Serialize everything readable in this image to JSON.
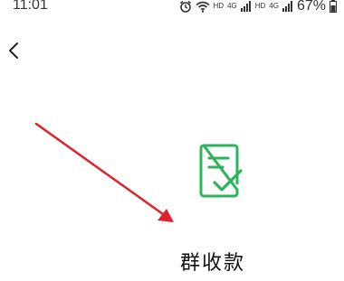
{
  "status_bar": {
    "time": "11:01",
    "network_1": "HD",
    "network_1_gen": "4G",
    "network_2": "HD",
    "network_2_gen": "4G",
    "battery_percent": "67%"
  },
  "header": {
    "back_icon": "chevron-left-icon"
  },
  "main": {
    "icon": "document-check-icon",
    "title": "群收款"
  },
  "colors": {
    "accent_green": "#2bb45a",
    "annotation_arrow": "#e0202a"
  }
}
